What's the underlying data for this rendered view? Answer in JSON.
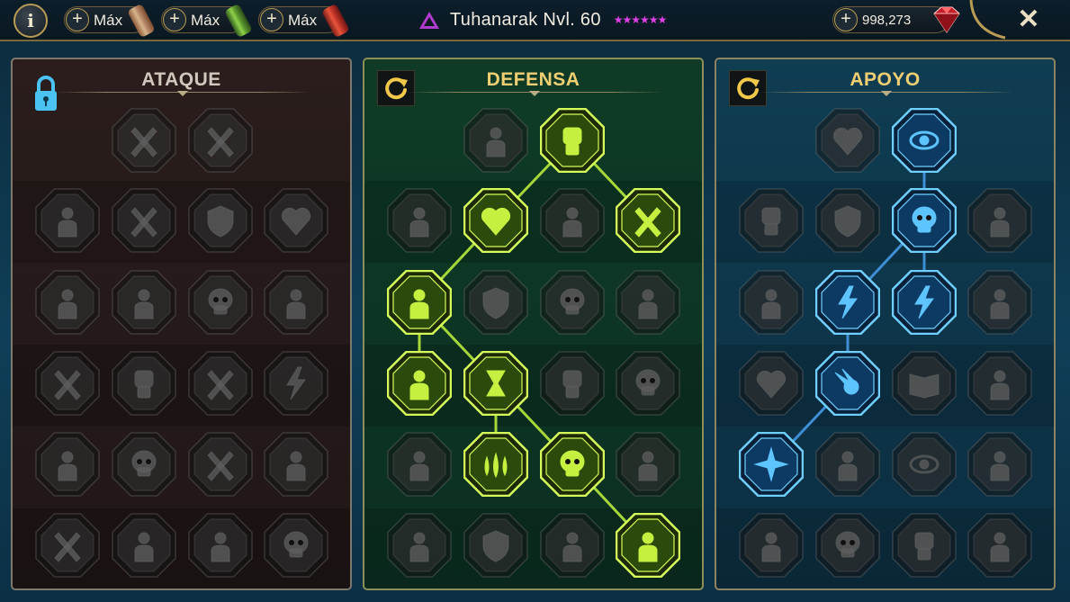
{
  "topbar": {
    "info_label": "i",
    "resources": [
      {
        "plus": "+",
        "label": "Máx",
        "color": "#c9a27a",
        "icon": "scroll-red-icon"
      },
      {
        "plus": "+",
        "label": "Máx",
        "color": "#6fa63a",
        "icon": "scroll-green-icon"
      },
      {
        "plus": "+",
        "label": "Máx",
        "color": "#d24a3a",
        "icon": "scroll-red-icon"
      }
    ],
    "hero_name": "Tuhanarak Nvl. 60",
    "hero_stars": "★★★★★★",
    "gems_plus": "+",
    "gems_value": "998,273",
    "close_label": "✕"
  },
  "colors": {
    "ataque_panel": "#2a1d1c",
    "defensa_panel": "#0f3b26",
    "apoyo_panel": "#0f3d52",
    "defensa_active": "#b8e837",
    "apoyo_active": "#3fb2f5",
    "title_gold": "#f0cf73"
  },
  "panels": [
    {
      "key": "ataque",
      "title": "ATAQUE",
      "state": "locked",
      "nodes": [
        {
          "row": 0,
          "col": 1,
          "icon": "crossed-swords-icon",
          "active": false
        },
        {
          "row": 0,
          "col": 2,
          "icon": "falling-blades-icon",
          "active": false
        },
        {
          "row": 1,
          "col": 0,
          "icon": "horned-warrior-icon",
          "active": false
        },
        {
          "row": 1,
          "col": 1,
          "icon": "sword-slash-icon",
          "active": false
        },
        {
          "row": 1,
          "col": 2,
          "icon": "shield-pierce-icon",
          "active": false
        },
        {
          "row": 1,
          "col": 3,
          "icon": "heart-claw-icon",
          "active": false
        },
        {
          "row": 2,
          "col": 0,
          "icon": "pouring-jug-icon",
          "active": false
        },
        {
          "row": 2,
          "col": 1,
          "icon": "fanged-maw-icon",
          "active": false
        },
        {
          "row": 2,
          "col": 2,
          "icon": "skull-slash-icon",
          "active": false
        },
        {
          "row": 2,
          "col": 3,
          "icon": "claw-strike-icon",
          "active": false
        },
        {
          "row": 3,
          "col": 0,
          "icon": "dagger-heart-icon",
          "active": false
        },
        {
          "row": 3,
          "col": 1,
          "icon": "fist-blade-icon",
          "active": false
        },
        {
          "row": 3,
          "col": 2,
          "icon": "axe-icon",
          "active": false
        },
        {
          "row": 3,
          "col": 3,
          "icon": "chain-lightning-icon",
          "active": false
        },
        {
          "row": 4,
          "col": 0,
          "icon": "spiked-tower-icon",
          "active": false
        },
        {
          "row": 4,
          "col": 1,
          "icon": "skull-cloud-icon",
          "active": false
        },
        {
          "row": 4,
          "col": 2,
          "icon": "sword-ring-icon",
          "active": false
        },
        {
          "row": 4,
          "col": 3,
          "icon": "brute-icon",
          "active": false
        },
        {
          "row": 5,
          "col": 0,
          "icon": "sparkle-blade-icon",
          "active": false
        },
        {
          "row": 5,
          "col": 1,
          "icon": "knight-helm-icon",
          "active": false
        },
        {
          "row": 5,
          "col": 2,
          "icon": "demon-wings-icon",
          "active": false
        },
        {
          "row": 5,
          "col": 3,
          "icon": "skull-crest-icon",
          "active": false
        }
      ],
      "links": []
    },
    {
      "key": "defensa",
      "title": "DEFENSA",
      "state": "unlocked",
      "nodes": [
        {
          "row": 0,
          "col": 1,
          "icon": "shattered-wall-icon",
          "active": false
        },
        {
          "row": 0,
          "col": 2,
          "icon": "raised-fist-icon",
          "active": true
        },
        {
          "row": 1,
          "col": 0,
          "icon": "hood-icon",
          "active": false
        },
        {
          "row": 1,
          "col": 1,
          "icon": "heart-anatomy-icon",
          "active": true
        },
        {
          "row": 1,
          "col": 2,
          "icon": "armored-chest-icon",
          "active": false
        },
        {
          "row": 1,
          "col": 3,
          "icon": "crossed-blades-icon",
          "active": true
        },
        {
          "row": 2,
          "col": 0,
          "icon": "warriors-icon",
          "active": true
        },
        {
          "row": 2,
          "col": 1,
          "icon": "shield-banner-icon",
          "active": false
        },
        {
          "row": 2,
          "col": 2,
          "icon": "skull-orb-icon",
          "active": false
        },
        {
          "row": 2,
          "col": 3,
          "icon": "bald-head-icon",
          "active": false
        },
        {
          "row": 3,
          "col": 0,
          "icon": "crowd-cheer-icon",
          "active": true
        },
        {
          "row": 3,
          "col": 1,
          "icon": "hourglass-burst-icon",
          "active": true
        },
        {
          "row": 3,
          "col": 2,
          "icon": "open-hand-icon",
          "active": false
        },
        {
          "row": 3,
          "col": 3,
          "icon": "bull-skull-icon",
          "active": false
        },
        {
          "row": 4,
          "col": 0,
          "icon": "running-figure-icon",
          "active": false
        },
        {
          "row": 4,
          "col": 1,
          "icon": "blood-drops-icon",
          "active": true
        },
        {
          "row": 4,
          "col": 2,
          "icon": "skull-sun-icon",
          "active": true
        },
        {
          "row": 4,
          "col": 3,
          "icon": "swirl-strike-icon",
          "active": false
        },
        {
          "row": 5,
          "col": 0,
          "icon": "ghoul-icon",
          "active": false
        },
        {
          "row": 5,
          "col": 1,
          "icon": "broken-shield-icon",
          "active": false
        },
        {
          "row": 5,
          "col": 2,
          "icon": "beast-face-icon",
          "active": false
        },
        {
          "row": 5,
          "col": 3,
          "icon": "flexing-figure-icon",
          "active": true
        }
      ],
      "links": [
        [
          [
            0,
            2
          ],
          [
            1,
            1
          ]
        ],
        [
          [
            0,
            2
          ],
          [
            1,
            3
          ]
        ],
        [
          [
            1,
            1
          ],
          [
            2,
            0
          ]
        ],
        [
          [
            2,
            0
          ],
          [
            3,
            0
          ]
        ],
        [
          [
            2,
            0
          ],
          [
            3,
            1
          ]
        ],
        [
          [
            3,
            1
          ],
          [
            4,
            1
          ]
        ],
        [
          [
            3,
            1
          ],
          [
            4,
            2
          ]
        ],
        [
          [
            4,
            2
          ],
          [
            5,
            3
          ]
        ]
      ]
    },
    {
      "key": "apoyo",
      "title": "APOYO",
      "state": "unlocked",
      "nodes": [
        {
          "row": 0,
          "col": 1,
          "icon": "heart-sparkles-icon",
          "active": false
        },
        {
          "row": 0,
          "col": 2,
          "icon": "radiant-eye-icon",
          "active": true
        },
        {
          "row": 1,
          "col": 0,
          "icon": "praying-hands-icon",
          "active": false
        },
        {
          "row": 1,
          "col": 1,
          "icon": "shield-arch-icon",
          "active": false
        },
        {
          "row": 1,
          "col": 2,
          "icon": "flaming-skull-icon",
          "active": true
        },
        {
          "row": 1,
          "col": 3,
          "icon": "arrow-lines-icon",
          "active": false
        },
        {
          "row": 2,
          "col": 0,
          "icon": "meditating-figure-icon",
          "active": false
        },
        {
          "row": 2,
          "col": 1,
          "icon": "lightning-shield-icon",
          "active": true
        },
        {
          "row": 2,
          "col": 2,
          "icon": "chain-lightning-icon",
          "active": true
        },
        {
          "row": 2,
          "col": 3,
          "icon": "hooded-figure-icon",
          "active": false
        },
        {
          "row": 3,
          "col": 0,
          "icon": "chained-heart-icon",
          "active": false
        },
        {
          "row": 3,
          "col": 1,
          "icon": "blue-comet-icon",
          "active": true
        },
        {
          "row": 3,
          "col": 2,
          "icon": "open-book-icon",
          "active": false
        },
        {
          "row": 3,
          "col": 3,
          "icon": "angry-face-icon",
          "active": false
        },
        {
          "row": 4,
          "col": 0,
          "icon": "compass-star-icon",
          "active": true
        },
        {
          "row": 4,
          "col": 1,
          "icon": "boot-icon",
          "active": false
        },
        {
          "row": 4,
          "col": 2,
          "icon": "eye-icon",
          "active": false
        },
        {
          "row": 4,
          "col": 3,
          "icon": "crossbones-icon",
          "active": false
        },
        {
          "row": 5,
          "col": 0,
          "icon": "potion-icon",
          "active": false
        },
        {
          "row": 5,
          "col": 1,
          "icon": "skull-icon",
          "active": false
        },
        {
          "row": 5,
          "col": 2,
          "icon": "fist-bones-icon",
          "active": false
        },
        {
          "row": 5,
          "col": 3,
          "icon": "eagle-head-icon",
          "active": false
        }
      ],
      "links": [
        [
          [
            0,
            2
          ],
          [
            1,
            2
          ]
        ],
        [
          [
            1,
            2
          ],
          [
            2,
            1
          ]
        ],
        [
          [
            1,
            2
          ],
          [
            2,
            2
          ]
        ],
        [
          [
            2,
            1
          ],
          [
            3,
            1
          ]
        ],
        [
          [
            3,
            1
          ],
          [
            4,
            0
          ]
        ]
      ]
    }
  ]
}
